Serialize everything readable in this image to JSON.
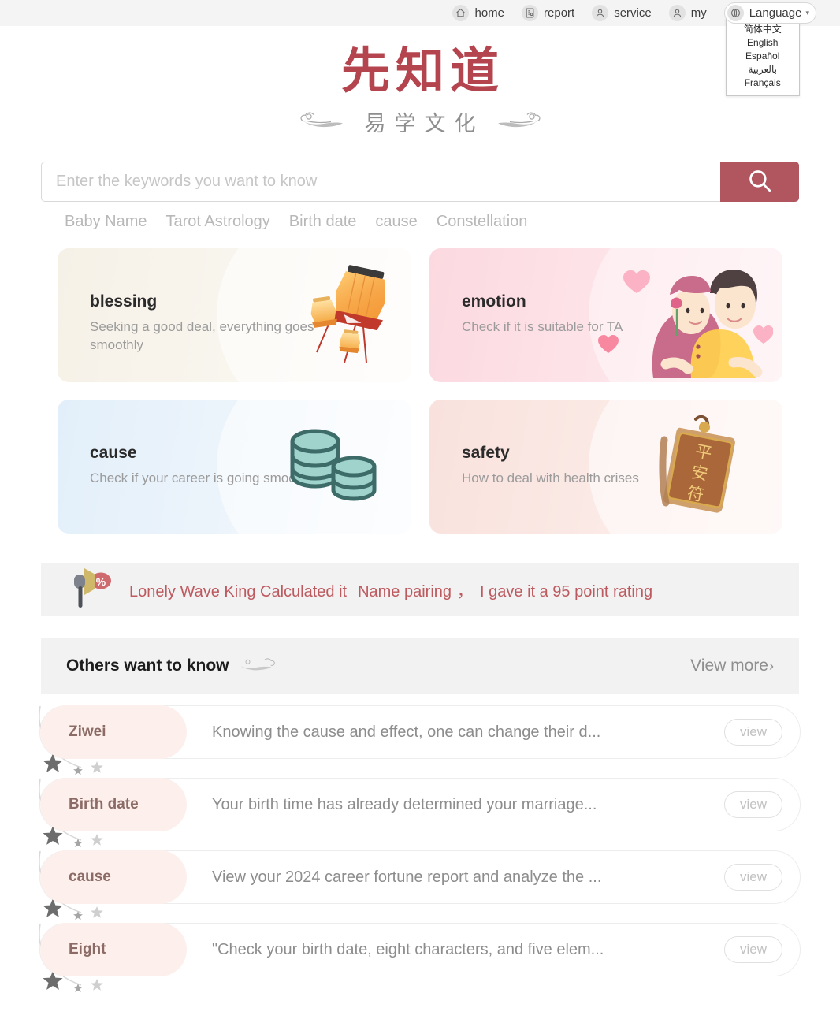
{
  "topnav": {
    "items": [
      {
        "label": "home",
        "icon": "home-icon"
      },
      {
        "label": "report",
        "icon": "report-icon"
      },
      {
        "label": "service",
        "icon": "service-icon"
      },
      {
        "label": "my",
        "icon": "user-icon"
      }
    ],
    "language": {
      "label": "Language",
      "icon": "globe-icon",
      "caret": "▾",
      "options": [
        "简体中文",
        "English",
        "Español",
        "بالعربية",
        "Français"
      ]
    }
  },
  "logo": {
    "main": "先知道",
    "sub": "易学文化"
  },
  "search": {
    "placeholder": "Enter the keywords you want to know",
    "value": "",
    "button_icon": "search-icon",
    "tags": [
      "Baby Name",
      "Tarot Astrology",
      "Birth date",
      "cause",
      "Constellation"
    ]
  },
  "cards": [
    {
      "title": "blessing",
      "desc": "Seeking a good deal, everything goes smoothly",
      "art": "lantern-illustration"
    },
    {
      "title": "emotion",
      "desc": "Check if it is suitable for TA",
      "art": "couple-illustration"
    },
    {
      "title": "cause",
      "desc": "Check if your career is going smoothly",
      "art": "coins-illustration"
    },
    {
      "title": "safety",
      "desc": "How to deal with health crises",
      "art": "amulet-illustration"
    }
  ],
  "notice": {
    "icon": "megaphone-percent-icon",
    "part1": "Lonely Wave King Calculated it",
    "part2": "Name pairing",
    "separator": "，",
    "part3": "I gave it a 95 point rating"
  },
  "section": {
    "title": "Others want to know",
    "ornament": "cloud-ornament-icon",
    "view_more": "View more",
    "chevron": "›"
  },
  "list": {
    "button_label": "view",
    "rows": [
      {
        "tag": "Ziwei",
        "text": "Knowing the cause and effect, one can change their d..."
      },
      {
        "tag": "Birth date",
        "text": "Your birth time has already determined your marriage..."
      },
      {
        "tag": "cause",
        "text": "View your 2024 career fortune report and analyze the ..."
      },
      {
        "tag": "Eight",
        "text": "\"Check your birth date, eight characters, and five elem..."
      }
    ]
  },
  "colors": {
    "brand_red": "#b4444e",
    "search_button": "#b1555f",
    "notice_text": "#bd5a5f",
    "nav_bg": "#f4f4f4",
    "panel_bg": "#f2f2f2",
    "tag_bg": "#fdf0ec"
  }
}
